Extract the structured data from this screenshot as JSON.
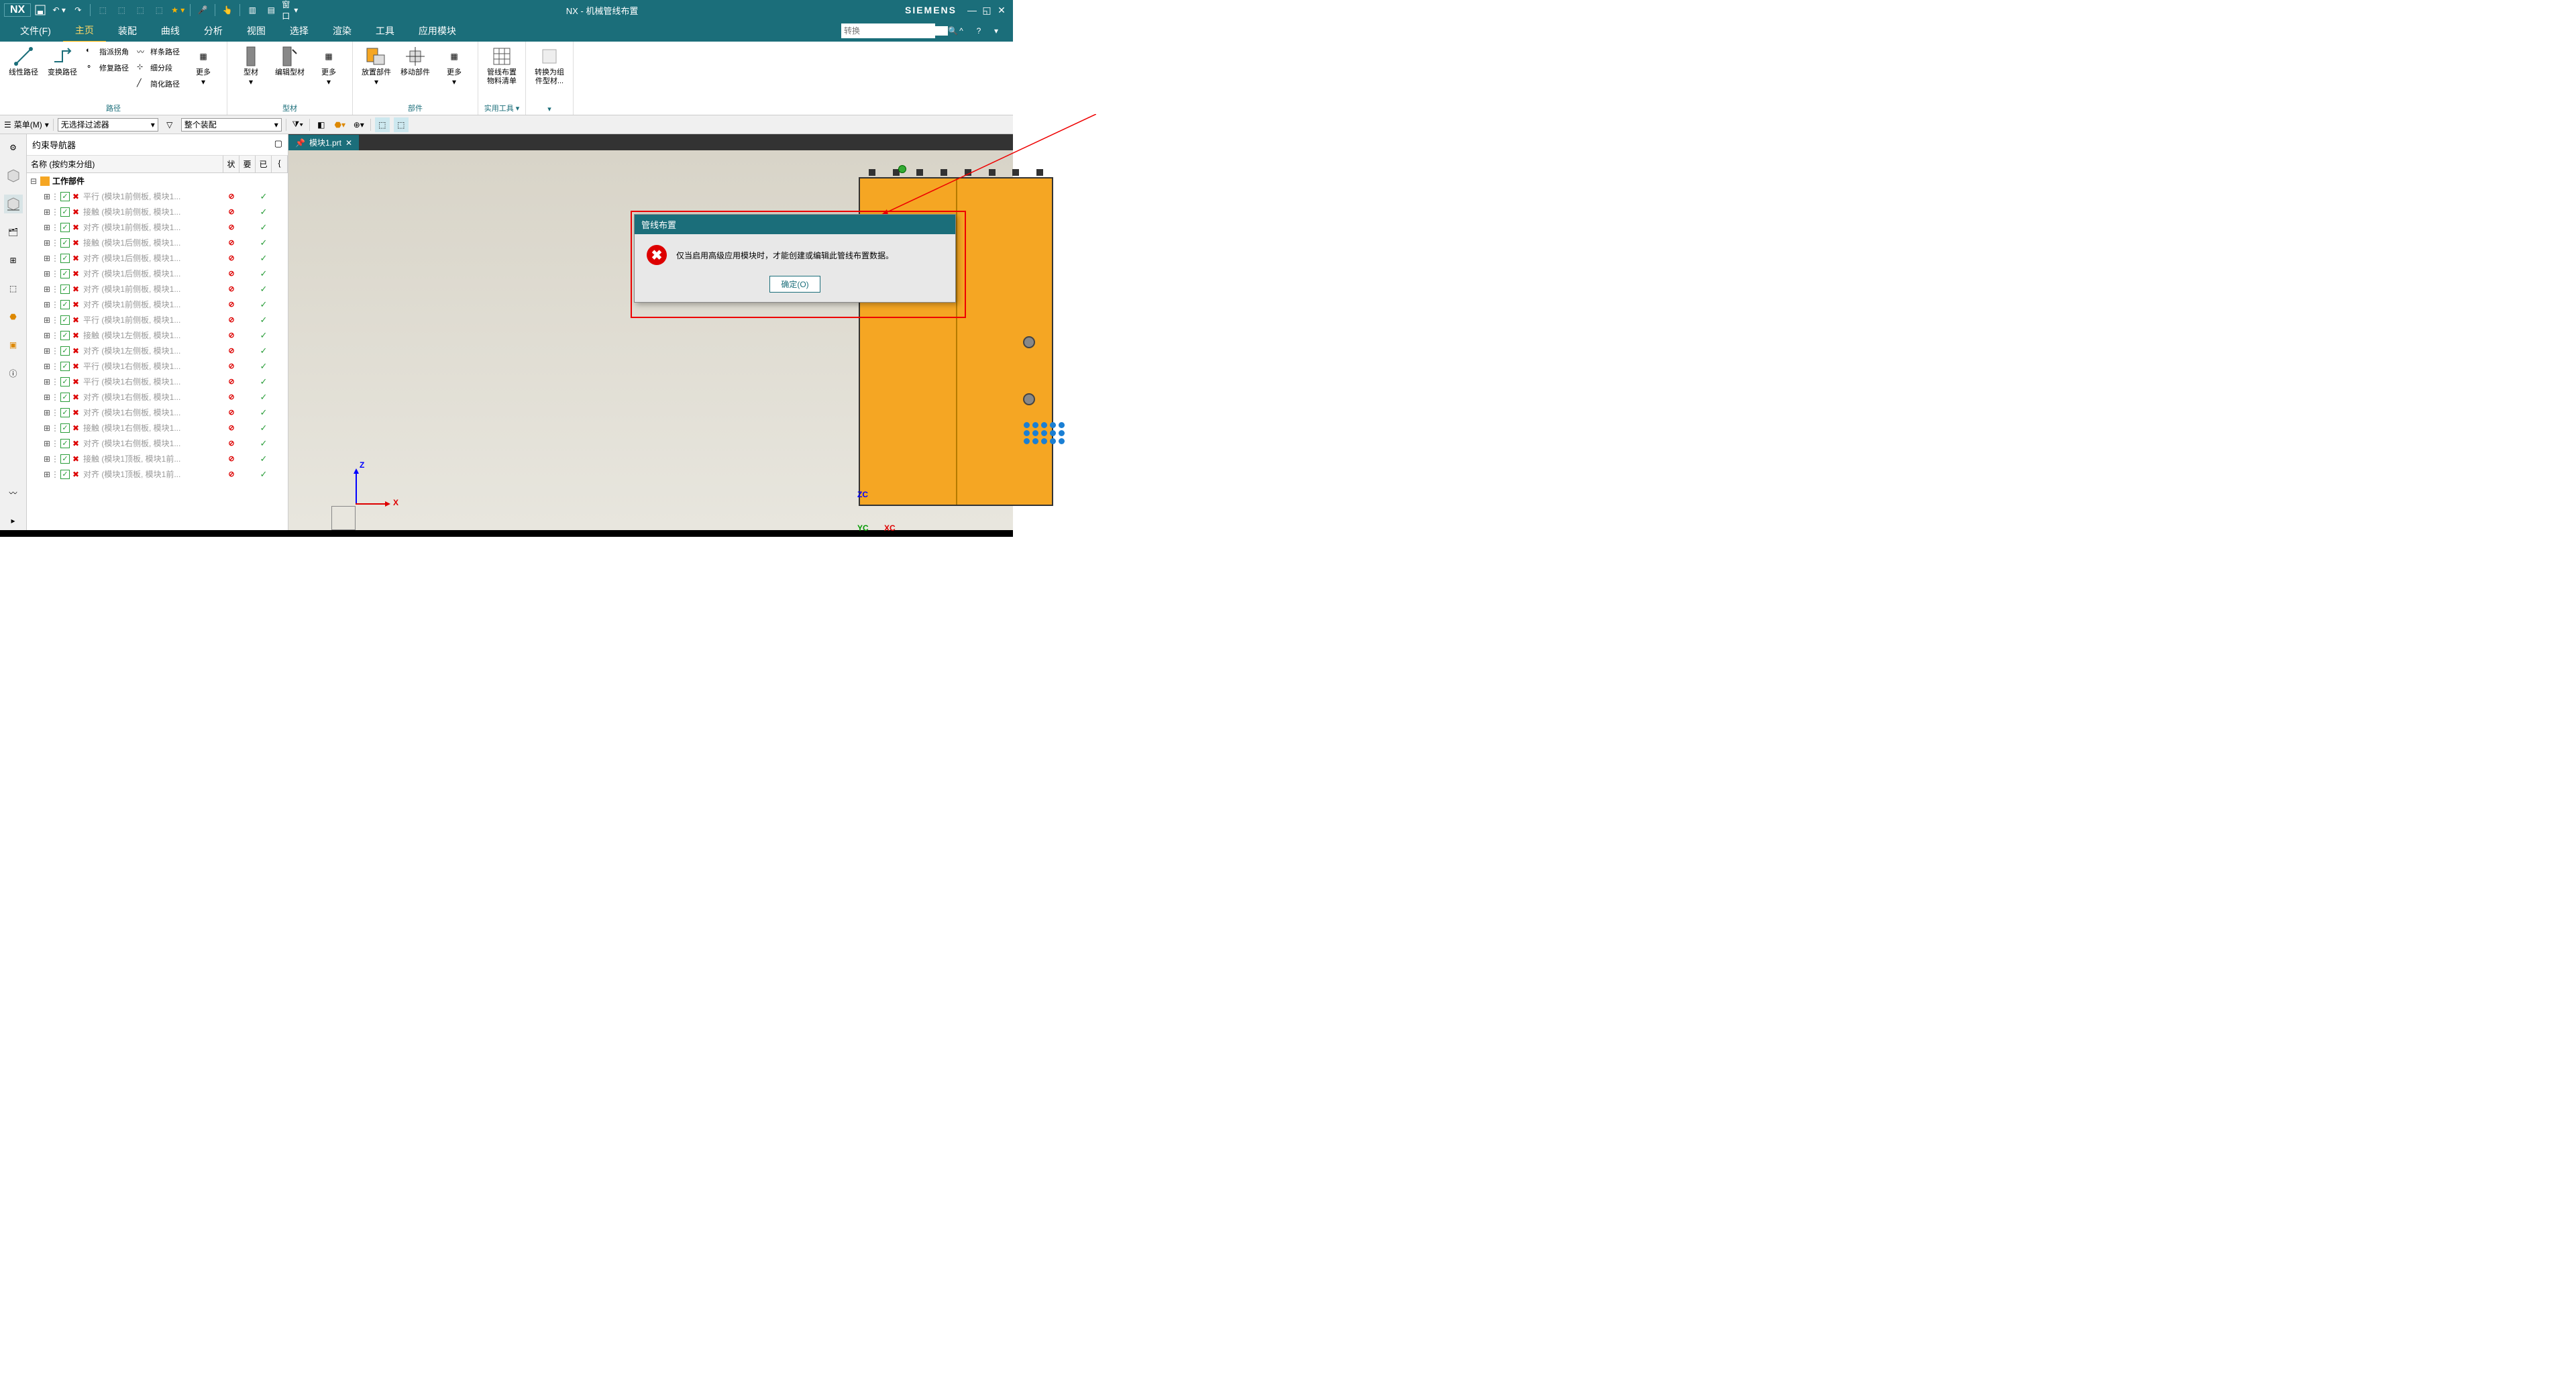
{
  "titlebar": {
    "app": "NX",
    "window_label": "窗口",
    "title": "NX - 机械管线布置",
    "brand": "SIEMENS"
  },
  "menu": {
    "file": "文件(F)",
    "home": "主页",
    "assembly": "装配",
    "curve": "曲线",
    "analysis": "分析",
    "view": "视图",
    "select": "选择",
    "render": "渲染",
    "tools": "工具",
    "app_module": "应用模块",
    "search_placeholder": "转换"
  },
  "ribbon": {
    "groups": {
      "path": {
        "label": "路径",
        "linear": "线性路径",
        "transform": "变换路径",
        "repair": "修复路径",
        "spline": "样条路径",
        "finger": "指派拐角",
        "subdiv": "细分段",
        "simplify": "简化路径",
        "more": "更多"
      },
      "stock": {
        "label": "型材",
        "stock": "型材",
        "edit_stock": "编辑型材",
        "more": "更多"
      },
      "part": {
        "label": "部件",
        "place": "放置部件",
        "move": "移动部件",
        "more": "更多"
      },
      "util": {
        "label": "实用工具",
        "bom": "管线布置物料清单"
      },
      "convert": {
        "label": "",
        "convert": "转换为组件型材..."
      }
    }
  },
  "filterbar": {
    "menu": "菜单(M)",
    "filter1": "无选择过滤器",
    "filter2": "整个装配"
  },
  "navigator": {
    "title": "约束导航器",
    "columns": {
      "name": "名称 (按约束分组)",
      "status": "状",
      "req": "要",
      "done": "已"
    },
    "root": "工作部件",
    "items": [
      {
        "type": "平行",
        "label": "平行 (模块1前侧板, 模块1..."
      },
      {
        "type": "接触",
        "label": "接触 (模块1前侧板, 模块1..."
      },
      {
        "type": "对齐",
        "label": "对齐 (模块1前侧板, 模块1..."
      },
      {
        "type": "接触",
        "label": "接触 (模块1后侧板, 模块1..."
      },
      {
        "type": "对齐",
        "label": "对齐 (模块1后侧板, 模块1..."
      },
      {
        "type": "对齐",
        "label": "对齐 (模块1后侧板, 模块1..."
      },
      {
        "type": "对齐",
        "label": "对齐 (模块1前侧板, 模块1..."
      },
      {
        "type": "对齐",
        "label": "对齐 (模块1前侧板, 模块1..."
      },
      {
        "type": "平行",
        "label": "平行 (模块1前侧板, 模块1..."
      },
      {
        "type": "接触",
        "label": "接触 (模块1左侧板, 模块1..."
      },
      {
        "type": "对齐",
        "label": "对齐 (模块1左侧板, 模块1..."
      },
      {
        "type": "平行",
        "label": "平行 (模块1右侧板, 模块1..."
      },
      {
        "type": "平行",
        "label": "平行 (模块1右侧板, 模块1..."
      },
      {
        "type": "对齐",
        "label": "对齐 (模块1右侧板, 模块1..."
      },
      {
        "type": "对齐",
        "label": "对齐 (模块1右侧板, 模块1..."
      },
      {
        "type": "接触",
        "label": "接触 (模块1右侧板, 模块1..."
      },
      {
        "type": "对齐",
        "label": "对齐 (模块1右侧板, 模块1..."
      },
      {
        "type": "接触",
        "label": "接触 (模块1顶板, 模块1前..."
      },
      {
        "type": "对齐",
        "label": "对齐 (模块1顶板, 模块1前..."
      }
    ]
  },
  "tab": {
    "name": "模块1.prt"
  },
  "axes": {
    "z": "Z",
    "x": "X",
    "zc": "ZC",
    "xc": "XC",
    "yc": "YC"
  },
  "dialog": {
    "title": "管线布置",
    "message": "仅当启用高级应用模块时，才能创建或编辑此管线布置数据。",
    "ok": "确定(O)"
  }
}
